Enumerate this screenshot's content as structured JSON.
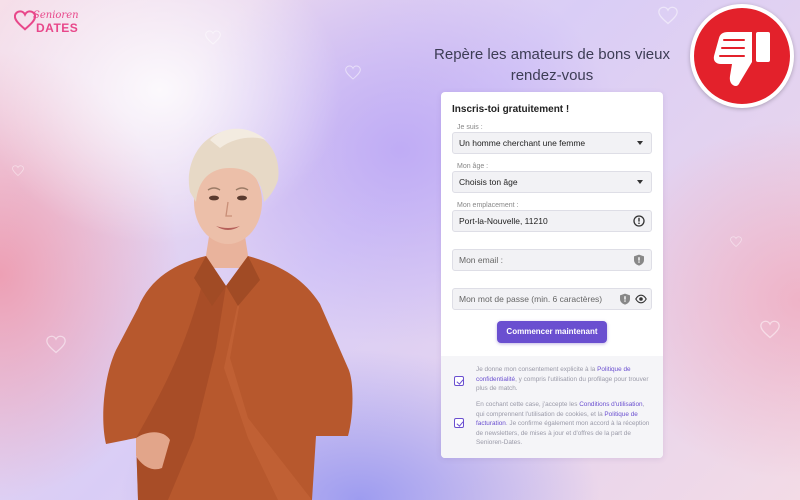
{
  "logo": {
    "word1": "Senioren",
    "word2": "DATES"
  },
  "headline": "Repère les amateurs de bons vieux rendez-vous",
  "form": {
    "title": "Inscris-toi gratuitement !",
    "iam_label": "Je suis :",
    "iam_value": "Un homme cherchant une femme",
    "age_label": "Mon âge :",
    "age_value": "Choisis ton âge",
    "location_label": "Mon emplacement :",
    "location_value": "Port-la-Nouvelle, 11210",
    "email_placeholder": "Mon email :",
    "password_placeholder": "Mon mot de passe (min. 6 caractères)",
    "submit_label": "Commencer maintenant"
  },
  "consent1": {
    "checked": true,
    "text_before": "Je donne mon consentement explicite à la ",
    "link1": "Politique de confidentialité",
    "text_after": ", y compris l'utilisation du profilage pour trouver plus de match."
  },
  "consent2": {
    "checked": true,
    "text_before": "En cochant cette case, j'accepte les ",
    "link1": "Conditions d'utilisation",
    "text_mid": ", qui comprennent l'utilisation de cookies, et la ",
    "link2": "Politique de facturation",
    "text_after": ". Je confirme également mon accord à la réception de newsletters, de mises à jour et d'offres de la part de Senioren-Dates."
  },
  "colors": {
    "accent": "#6a4fd0",
    "brand": "#e8478a",
    "badge": "#e3212b"
  },
  "icons": {
    "badge": "thumbs-down-icon",
    "location": "alert-circle-icon",
    "email": "shield-icon",
    "password_shield": "shield-icon",
    "password_eye": "eye-icon"
  }
}
